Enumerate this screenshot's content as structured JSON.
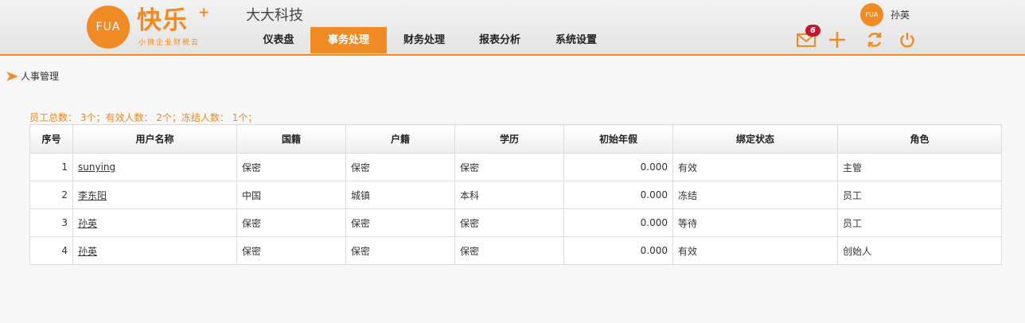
{
  "brand": {
    "circle_text": "FUA",
    "title": "快乐",
    "plus": "+",
    "subtitle": "小微企业财税云",
    "accent": "#f08a24"
  },
  "company": "大大科技",
  "nav": {
    "items": [
      {
        "label": "仪表盘"
      },
      {
        "label": "事务处理",
        "active": true
      },
      {
        "label": "财务处理"
      },
      {
        "label": "报表分析"
      },
      {
        "label": "系统设置"
      }
    ]
  },
  "user": {
    "avatar_text": "FUA",
    "name": "孙英"
  },
  "toolbar": {
    "mail_badge": "6",
    "icons": [
      "mail-icon",
      "plus-icon",
      "refresh-icon",
      "power-icon"
    ]
  },
  "breadcrumb": {
    "label": "人事管理"
  },
  "summary": "员工总数： 3个；有效人数： 2个；冻结人数： 1个；",
  "table": {
    "columns": [
      "序号",
      "用户名称",
      "国籍",
      "户籍",
      "学历",
      "初始年假",
      "绑定状态",
      "角色"
    ],
    "rows": [
      [
        "1",
        "sunying",
        "保密",
        "保密",
        "保密",
        "0.000",
        "有效",
        "主管"
      ],
      [
        "2",
        "李东阳",
        "中国",
        "城镇",
        "本科",
        "0.000",
        "冻结",
        "员工"
      ],
      [
        "3",
        "孙英",
        "保密",
        "保密",
        "保密",
        "0.000",
        "等待",
        "员工"
      ],
      [
        "4",
        "孙英",
        "保密",
        "保密",
        "保密",
        "0.000",
        "有效",
        "创始人"
      ]
    ]
  }
}
